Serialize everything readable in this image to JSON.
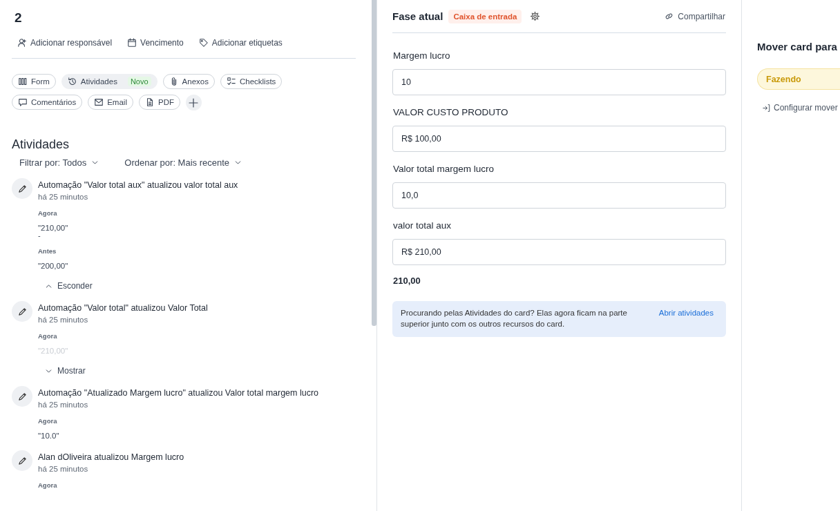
{
  "card": {
    "title": "2",
    "actions": [
      {
        "label": "Adicionar responsável"
      },
      {
        "label": "Vencimento"
      },
      {
        "label": "Adicionar etiquetas"
      }
    ],
    "tabs": [
      {
        "label": "Form",
        "selected": false
      },
      {
        "label": "Atividades",
        "badge": "Novo",
        "selected": true
      },
      {
        "label": "Anexos",
        "selected": false
      },
      {
        "label": "Checklists",
        "selected": false
      },
      {
        "label": "Comentários",
        "selected": false
      },
      {
        "label": "Email",
        "selected": false
      },
      {
        "label": "PDF",
        "selected": false
      }
    ]
  },
  "activities": {
    "heading": "Atividades",
    "filter": "Filtrar por: Todos",
    "order": "Ordenar por: Mais recente",
    "items": [
      {
        "title": "Automação \"Valor total aux\" atualizou valor total aux",
        "time": "há 25 minutos",
        "now_label": "Agora",
        "now_value": "\"210,00\"",
        "separator": "-",
        "before_label": "Antes",
        "before_value": "\"200,00\"",
        "toggle": {
          "label": "Esconder",
          "expanded": true
        }
      },
      {
        "title": "Automação \"Valor total\" atualizou Valor Total",
        "time": "há 25 minutos",
        "now_label": "Agora",
        "now_value": "\"210,00\"",
        "toggle": {
          "label": "Mostrar",
          "expanded": false
        }
      },
      {
        "title": "Automação \"Atualizado Margem lucro\" atualizou Valor total margem lucro",
        "time": "há 25 minutos",
        "now_label": "Agora",
        "now_value": "\"10.0\""
      },
      {
        "title": "Alan dOliveira atualizou Margem lucro",
        "time": "há 25 minutos",
        "now_label": "Agora"
      }
    ]
  },
  "phase": {
    "label": "Fase atual",
    "name": "Caixa de entrada",
    "share": "Compartilhar",
    "fields": [
      {
        "label": "Margem lucro",
        "value": "10"
      },
      {
        "label": "VALOR CUSTO PRODUTO",
        "value": "R$ 100,00"
      },
      {
        "label": "Valor total margem lucro",
        "value": "10,0"
      },
      {
        "label": "valor total aux",
        "value": "R$ 210,00"
      }
    ],
    "result": "210,00",
    "notice": {
      "text": "Procurando pelas Atividades do card? Elas agora ficam na parte superior junto com os outros recursos do card.",
      "link": "Abrir atividades"
    }
  },
  "move": {
    "heading": "Mover card para",
    "target": "Fazendo",
    "configure": "Configurar mover"
  }
}
